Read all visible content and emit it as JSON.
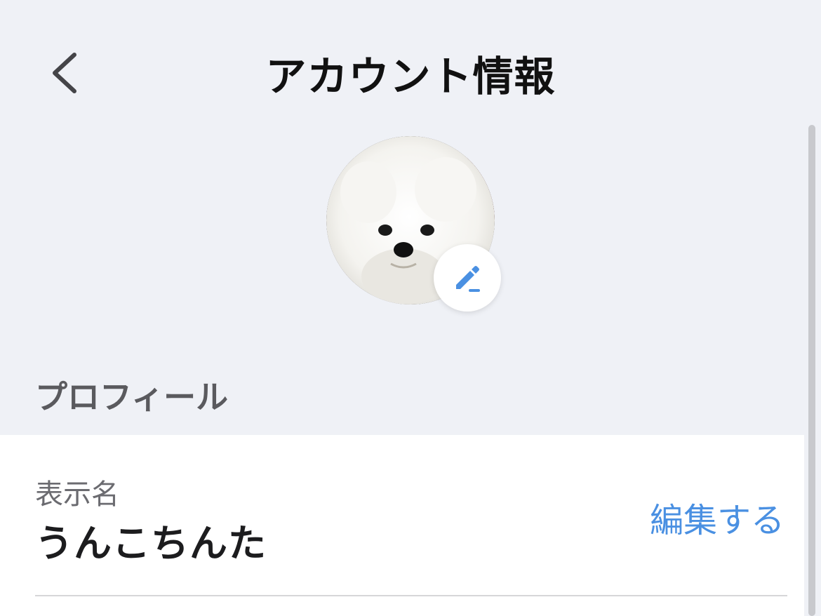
{
  "header": {
    "title": "アカウント情報",
    "back_icon": "chevron-left-icon"
  },
  "avatar": {
    "edit_icon": "pencil-icon",
    "accent_color": "#4a90e2"
  },
  "section": {
    "title": "プロフィール"
  },
  "profile": {
    "display_name_label": "表示名",
    "display_name_value": "うんこちんた",
    "edit_label": "編集する"
  },
  "colors": {
    "background": "#eff1f6",
    "card": "#ffffff",
    "link": "#4a90e2"
  }
}
